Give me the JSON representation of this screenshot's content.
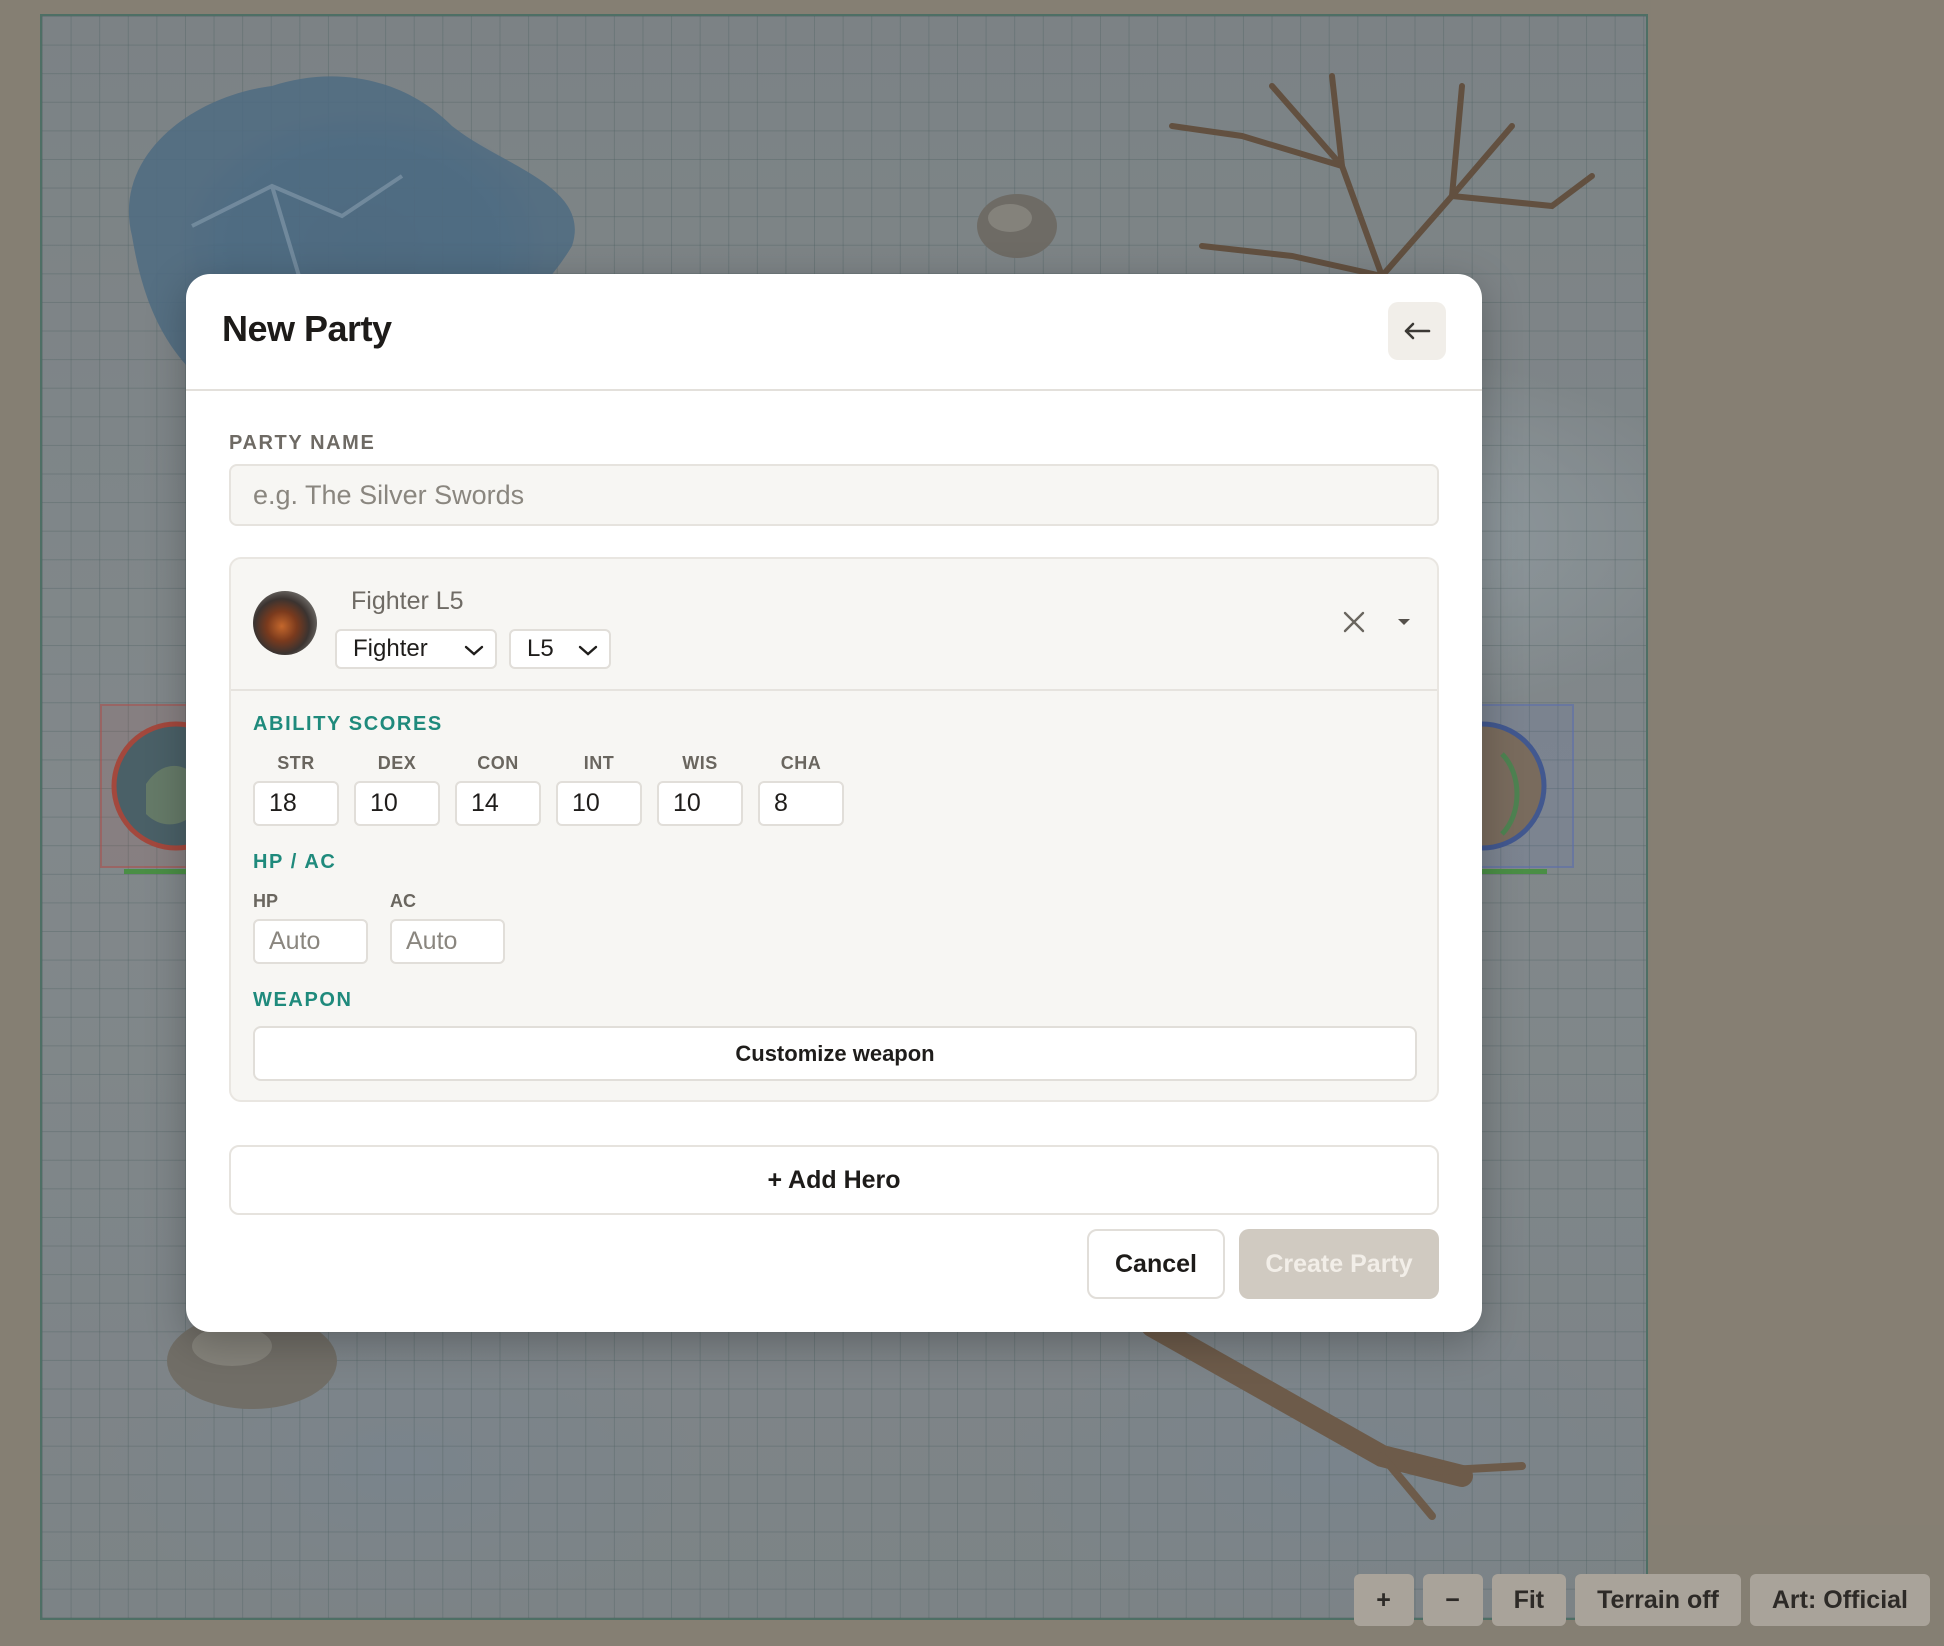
{
  "map": {
    "controls": {
      "zoom_in": "+",
      "zoom_out": "−",
      "fit": "Fit",
      "terrain": "Terrain off",
      "art": "Art: Official"
    }
  },
  "modal": {
    "title": "New Party",
    "party_name": {
      "label": "PARTY NAME",
      "placeholder": "e.g. The Silver Swords",
      "value": ""
    },
    "hero": {
      "name": "Fighter L5",
      "class_select": "Fighter",
      "level_select": "L5",
      "sections": {
        "abilities": "ABILITY SCORES",
        "hpac": "HP / AC",
        "weapon": "WEAPON"
      },
      "abilities": [
        {
          "label": "STR",
          "value": "18"
        },
        {
          "label": "DEX",
          "value": "10"
        },
        {
          "label": "CON",
          "value": "14"
        },
        {
          "label": "INT",
          "value": "10"
        },
        {
          "label": "WIS",
          "value": "10"
        },
        {
          "label": "CHA",
          "value": "8"
        }
      ],
      "hp": {
        "label": "HP",
        "placeholder": "Auto"
      },
      "ac": {
        "label": "AC",
        "placeholder": "Auto"
      },
      "weapon_button": "Customize weapon"
    },
    "add_hero": "+ Add Hero",
    "cancel": "Cancel",
    "create": "Create Party"
  }
}
